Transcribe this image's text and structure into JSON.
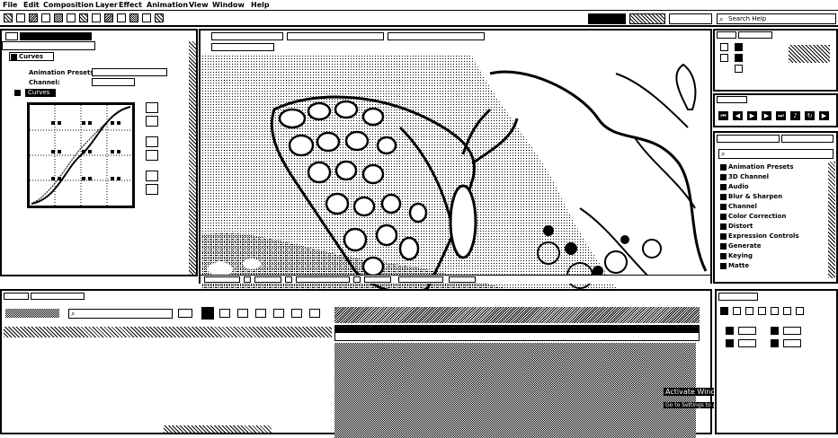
{
  "menu": [
    "File",
    "Edit",
    "Composition",
    "Layer",
    "Effect",
    "Animation",
    "View",
    "Window",
    "Help"
  ],
  "toolbar": {
    "search_placeholder": "Search Help"
  },
  "effect_controls": {
    "effect_name": "Curves",
    "animation_presets_label": "Animation Presets:",
    "channel_label": "Channel:",
    "curves_label": "Curves"
  },
  "effects_panel": {
    "categories": [
      "Animation Presets",
      "3D Channel",
      "Audio",
      "Blur & Sharpen",
      "Channel",
      "Color Correction",
      "Distort",
      "Expression Controls",
      "Generate",
      "Keying",
      "Matte"
    ]
  },
  "watermark": {
    "line1": "Activate Windows",
    "line2": "Go to Settings to activate Windows."
  },
  "colors": {
    "foreground": "#000000",
    "background": "#ffffff"
  }
}
